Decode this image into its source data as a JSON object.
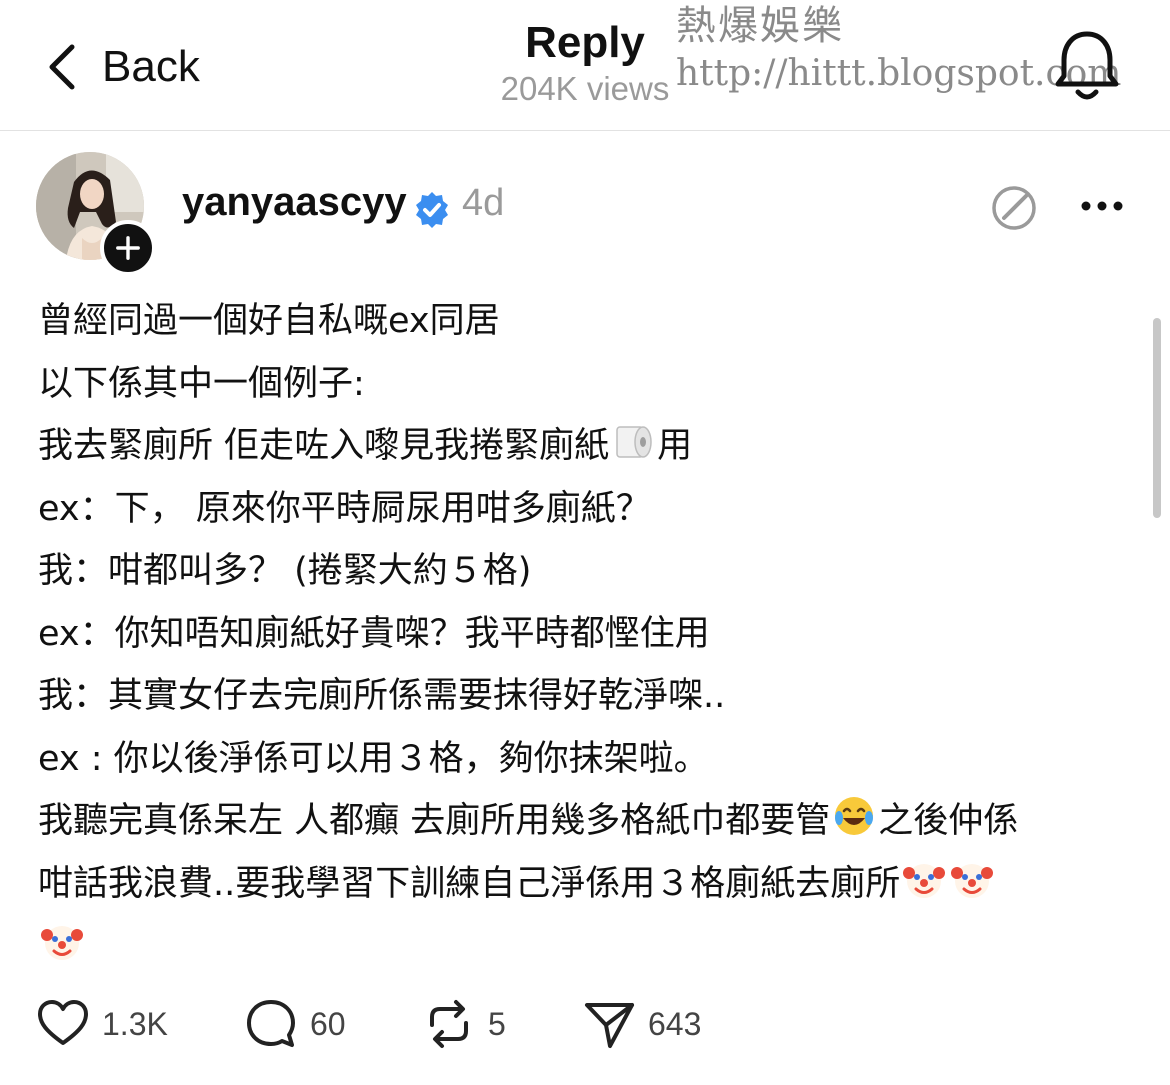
{
  "header": {
    "back_label": "Back",
    "title": "Reply",
    "views": "204K views",
    "watermark_line1": "熱爆娛樂",
    "watermark_line2": "http://hittt.blogspot.com"
  },
  "post": {
    "username": "yanyaascyy",
    "time_ago": "4d",
    "verified": true,
    "lines": [
      "曾經同過一個好自私嘅ex同居",
      "以下係其中一個例子:",
      "我去緊廁所 佢走咗入嚟見我捲緊廁紙",
      "用",
      "ex：下， 原來你平時屙尿用咁多廁紙？",
      "我：咁都叫多？ (捲緊大約５格)",
      "ex：你知唔知廁紙好貴㗎？我平時都慳住用",
      "我：其實女仔去完廁所係需要抹得好乾淨㗎..",
      "ex : 你以後淨係可以用３格，夠你抹架啦。",
      "我聽完真係呆左 人都癲 去廁所用幾多格紙巾都要管",
      "之後仲係",
      "咁話我浪費..要我學習下訓練自己淨係用３格廁紙去廁所"
    ],
    "emoji": {
      "toilet_paper": "toilet-paper-emoji",
      "laugh": "tears-of-joy-emoji",
      "clown": "clown-face-emoji"
    }
  },
  "actions": {
    "likes": "1.3K",
    "comments": "60",
    "reposts": "5",
    "shares": "643"
  },
  "icons": {
    "back": "chevron-left-icon",
    "bell": "bell-icon",
    "verified": "verified-badge-icon",
    "more": "more-dots-icon",
    "like": "heart-icon",
    "comment": "comment-icon",
    "repost": "repost-icon",
    "share": "send-icon"
  },
  "colors": {
    "text": "#111111",
    "muted": "#9a9a9a",
    "verified": "#3b8ef0",
    "divider": "#e2e2e2"
  }
}
